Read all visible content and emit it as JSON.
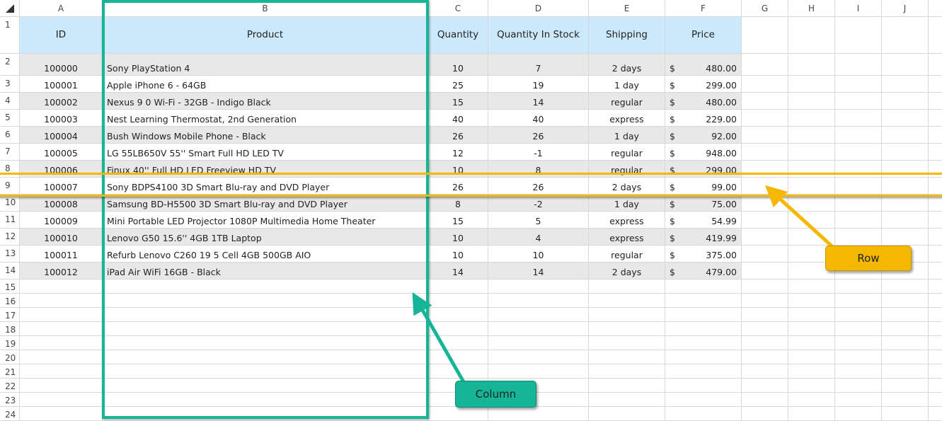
{
  "columns": [
    "A",
    "B",
    "C",
    "D",
    "E",
    "F",
    "G",
    "H",
    "I",
    "J"
  ],
  "header_row": [
    "ID",
    "Product",
    "Quantity",
    "Quantity In Stock",
    "Shipping",
    "Price"
  ],
  "rows": [
    [
      "100000",
      "Sony PlayStation 4",
      "10",
      "7",
      "2 days",
      "480.00"
    ],
    [
      "100001",
      "Apple iPhone 6 - 64GB",
      "25",
      "19",
      "1 day",
      "299.00"
    ],
    [
      "100002",
      "Nexus 9 0 Wi-Fi - 32GB - Indigo Black",
      "15",
      "14",
      "regular",
      "480.00"
    ],
    [
      "100003",
      "Nest Learning Thermostat, 2nd Generation",
      "40",
      "40",
      "express",
      "229.00"
    ],
    [
      "100004",
      "Bush Windows Mobile Phone - Black",
      "26",
      "26",
      "1 day",
      "92.00"
    ],
    [
      "100005",
      "LG 55LB650V 55'' Smart Full HD LED TV",
      "12",
      "-1",
      "regular",
      "948.00"
    ],
    [
      "100006",
      "Finux 40'' Full HD LED Freeview HD TV",
      "10",
      "8",
      "regular",
      "299.00"
    ],
    [
      "100007",
      "Sony BDPS4100 3D Smart Blu-ray and DVD Player",
      "26",
      "26",
      "2 days",
      "99.00"
    ],
    [
      "100008",
      "Samsung BD-H5500 3D Smart Blu-ray and DVD Player",
      "8",
      "-2",
      "1 day",
      "75.00"
    ],
    [
      "100009",
      "Mini Portable LED Projector 1080P Multimedia Home Theater",
      "15",
      "5",
      "express",
      "54.99"
    ],
    [
      "100010",
      "Lenovo G50 15.6'' 4GB 1TB Laptop",
      "10",
      "4",
      "express",
      "419.99"
    ],
    [
      "100011",
      "Refurb Lenovo C260 19 5 Cell 4GB 500GB AIO",
      "10",
      "10",
      "regular",
      "375.00"
    ],
    [
      "100012",
      "iPad Air WiFi 16GB - Black",
      "14",
      "14",
      "2 days",
      "479.00"
    ]
  ],
  "currency_symbol": "$",
  "row_numbers": [
    "1",
    "2",
    "3",
    "4",
    "5",
    "6",
    "7",
    "8",
    "9",
    "10",
    "11",
    "12",
    "13",
    "14",
    "15",
    "16",
    "17",
    "18",
    "19",
    "20",
    "21",
    "22",
    "23",
    "24"
  ],
  "annotations": {
    "row_label": "Row",
    "column_label": "Column",
    "row_color": "#f5b800",
    "column_color": "#17b597"
  },
  "colors": {
    "header_fill": "#cce9fb",
    "band_fill": "#e8e8e8"
  }
}
